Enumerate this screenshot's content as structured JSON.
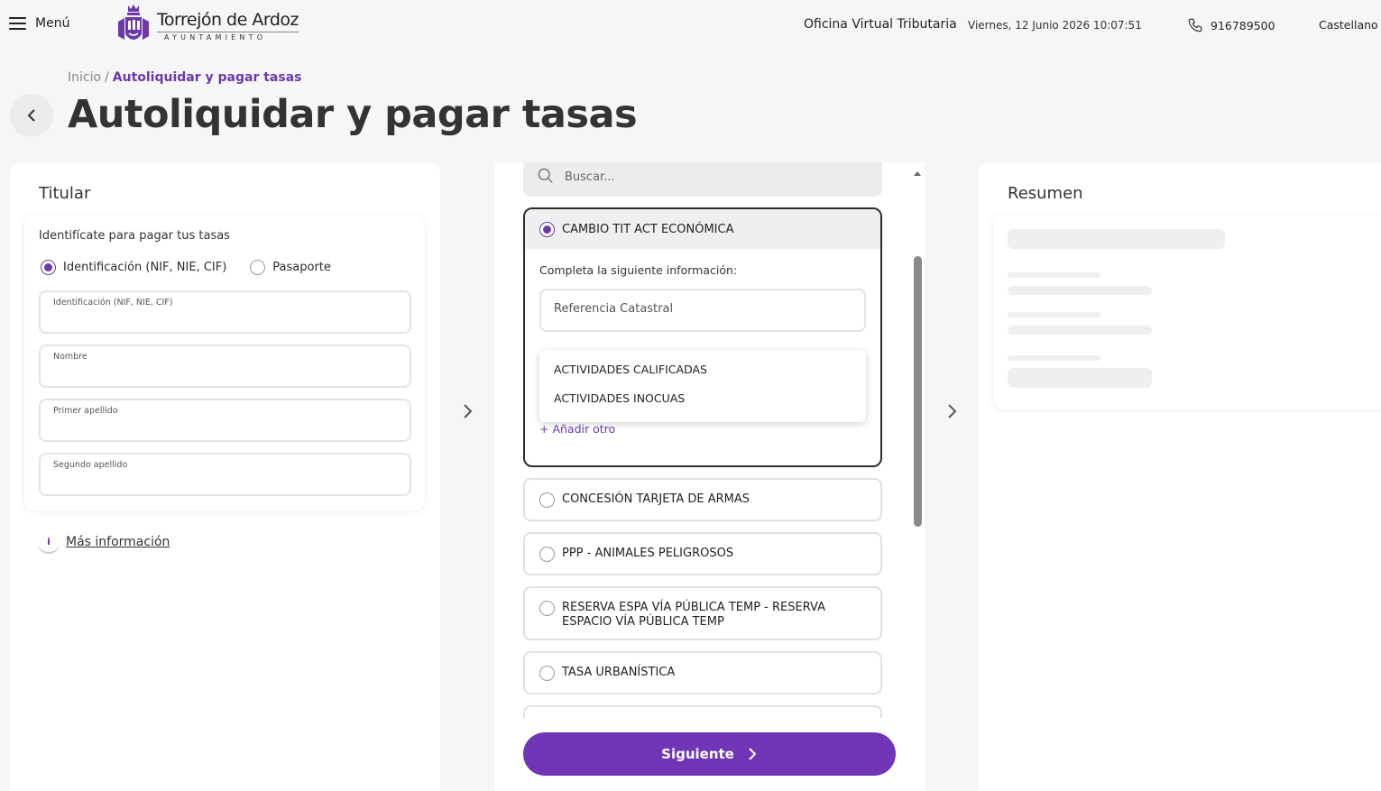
{
  "header": {
    "menu_label": "Menú",
    "logo_name": "Torrejón de Ardoz",
    "logo_sub": "AYUNTAMIENTO",
    "office": "Oficina Virtual Tributaria",
    "datetime": "Viernes, 12 Junio 2026 10:07:51",
    "phone": "916789500",
    "language": "Castellano"
  },
  "breadcrumb": {
    "home": "Inicio",
    "separator": "/",
    "current": "Autoliquidar y pagar tasas"
  },
  "page_title": "Autoliquidar y pagar tasas",
  "titular": {
    "heading": "Titular",
    "prompt": "Identifícate para pagar tus tasas",
    "id_types": [
      {
        "label": "Identificación (NIF, NIE, CIF)",
        "selected": true
      },
      {
        "label": "Pasaporte",
        "selected": false
      }
    ],
    "fields": [
      {
        "label": "Identificación (NIF, NIE, CIF)",
        "value": ""
      },
      {
        "label": "Nombre",
        "value": ""
      },
      {
        "label": "Primer apellido",
        "value": ""
      },
      {
        "label": "Segundo apellido",
        "value": ""
      }
    ],
    "more_info": "Más información",
    "info_icon_glyph": "i"
  },
  "taxes": {
    "search_placeholder": "Buscar...",
    "selected": {
      "label": "CAMBIO TIT ACT ECONÓMICA",
      "instructions": "Completa la siguiente información:",
      "ref_placeholder": "Referencia Catastral",
      "dropdown_options": [
        "ACTIVIDADES CALIFICADAS",
        "ACTIVIDADES INOCUAS"
      ],
      "add_other": "+ Añadir otro"
    },
    "options": [
      {
        "label": "CONCESIÓN TARJETA DE ARMAS"
      },
      {
        "label": "PPP - ANIMALES PELIGROSOS"
      },
      {
        "label": "RESERVA ESPA VÍA PÚBLICA TEMP - RESERVA ESPACIO VÍA PÚBLICA TEMP"
      },
      {
        "label": "TASA URBANÍSTICA"
      }
    ],
    "next_button": "Siguiente"
  },
  "summary": {
    "heading": "Resumen"
  },
  "colors": {
    "accent": "#6f35b5",
    "link": "#6b3aa8",
    "background": "#f6f6f8"
  }
}
